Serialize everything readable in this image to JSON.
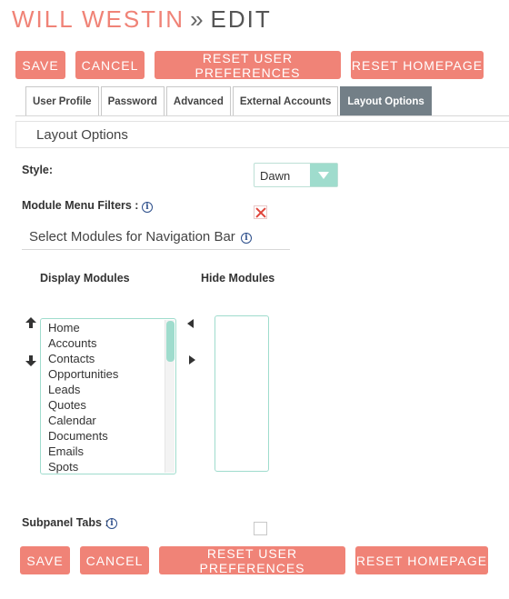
{
  "header": {
    "name": "WILL WESTIN",
    "separator": "»",
    "action": "EDIT"
  },
  "buttons": {
    "save": "SAVE",
    "cancel": "CANCEL",
    "reset_prefs": "RESET USER PREFERENCES",
    "reset_homepage": "RESET HOMEPAGE"
  },
  "tabs": [
    {
      "label": "User Profile",
      "active": false
    },
    {
      "label": "Password",
      "active": false
    },
    {
      "label": "Advanced",
      "active": false
    },
    {
      "label": "External Accounts",
      "active": false
    },
    {
      "label": "Layout Options",
      "active": true
    }
  ],
  "section": {
    "title": "Layout Options"
  },
  "style_field": {
    "label": "Style:",
    "value": "Dawn"
  },
  "module_menu_filters": {
    "label": "Module Menu Filters :",
    "checked": true
  },
  "nav_bar": {
    "heading": "Select Modules for Navigation Bar",
    "display_label": "Display Modules",
    "hide_label": "Hide Modules",
    "display_modules": [
      "Home",
      "Accounts",
      "Contacts",
      "Opportunities",
      "Leads",
      "Quotes",
      "Calendar",
      "Documents",
      "Emails",
      "Spots"
    ],
    "hide_modules": []
  },
  "subpanel_tabs": {
    "label": "Subpanel Tabs :",
    "checked": false
  },
  "icons": {
    "info": "info-icon",
    "up": "up-arrow-icon",
    "down": "down-arrow-icon",
    "left": "move-left-icon",
    "right": "move-right-icon",
    "dropdown": "chevron-down-icon"
  },
  "colors": {
    "accent": "#f08377",
    "tab_active": "#737f87",
    "select_accent": "#9fdccd"
  }
}
